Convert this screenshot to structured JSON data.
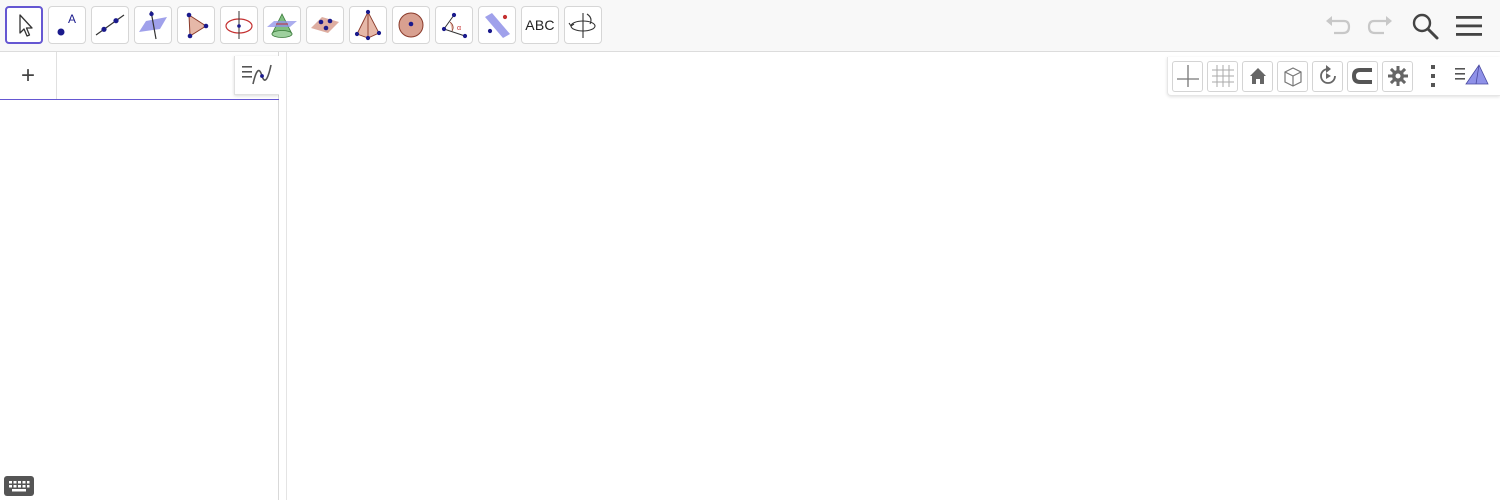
{
  "toolbar": {
    "tools": [
      {
        "name": "move-tool",
        "icon": "cursor-arrow-icon"
      },
      {
        "name": "point-tool",
        "icon": "point-icon"
      },
      {
        "name": "line-tool",
        "icon": "line-icon"
      },
      {
        "name": "perpendicular-line-tool",
        "icon": "perpendicular-line-icon"
      },
      {
        "name": "polygon-tool",
        "icon": "polygon-icon"
      },
      {
        "name": "circle-axis-tool",
        "icon": "circle-axis-icon"
      },
      {
        "name": "intersect-surfaces-tool",
        "icon": "cone-plane-icon"
      },
      {
        "name": "plane-three-points-tool",
        "icon": "plane-points-icon"
      },
      {
        "name": "pyramid-tool",
        "icon": "pyramid-icon"
      },
      {
        "name": "sphere-tool",
        "icon": "sphere-icon"
      },
      {
        "name": "angle-tool",
        "icon": "angle-icon"
      },
      {
        "name": "reflect-tool",
        "icon": "reflect-plane-icon"
      },
      {
        "name": "text-tool",
        "label": "ABC"
      },
      {
        "name": "rotate-view-tool",
        "icon": "rotate-3d-icon"
      }
    ],
    "active_tool": "move-tool"
  },
  "algebra": {
    "add_label": "+"
  },
  "style_bar": {
    "buttons": [
      "axes-icon",
      "grid-icon",
      "home-icon",
      "view-direction-icon",
      "rotate-view-icon",
      "point-capturing-icon",
      "settings-icon",
      "more-vert-icon",
      "perspectives-icon"
    ]
  },
  "colors": {
    "accent": "#6557d2",
    "point": "#1a1a8c",
    "plane": "#8f91e8",
    "solid": "#d8a090"
  }
}
